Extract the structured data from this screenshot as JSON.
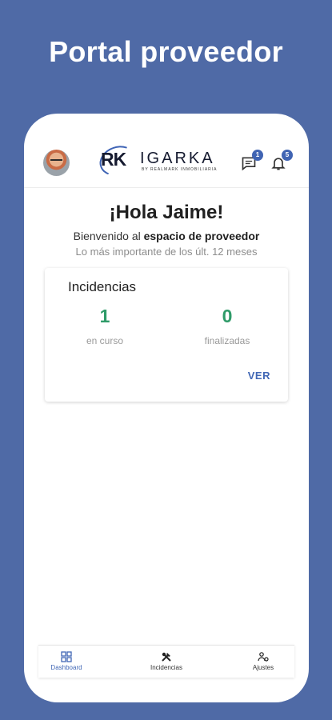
{
  "promo": {
    "title": "Portal proveedor"
  },
  "brand": {
    "mark": "RK",
    "name": "IGARKA",
    "tagline": "BY REALMARK INMOBILIARIA",
    "accent": "#4064b3"
  },
  "header": {
    "avatar": "user-avatar",
    "messages": {
      "icon": "chat-icon",
      "count": "1"
    },
    "notifications": {
      "icon": "bell-icon",
      "count": "5"
    }
  },
  "greeting": {
    "title": "¡Hola Jaime!",
    "welcome_prefix": "Bienvenido al",
    "welcome_bold": "espacio de proveedor",
    "subtitle": "Lo más importante de los últ. 12 meses"
  },
  "card": {
    "title": "Incidencias",
    "in_progress": {
      "value": "1",
      "label": "en curso"
    },
    "finished": {
      "value": "0",
      "label": "finalizadas"
    },
    "action": "VER"
  },
  "nav": {
    "items": [
      {
        "label": "Dashboard",
        "icon": "dashboard-icon"
      },
      {
        "label": "Incidencias",
        "icon": "tools-icon"
      },
      {
        "label": "Ajustes",
        "icon": "settings-icon"
      }
    ]
  },
  "colors": {
    "background": "#4f6aa6",
    "stat": "#2f9b69",
    "link": "#4167b5"
  }
}
